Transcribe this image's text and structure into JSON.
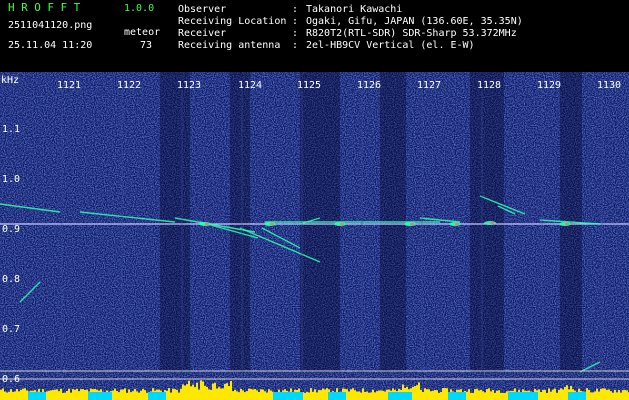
{
  "header": {
    "app_title": "HROFFT",
    "app_version": "1.0.0",
    "file_name": "2511041120.png",
    "timestamp": "25.11.04 11:20",
    "mode_label": "meteor",
    "mode_count": "73"
  },
  "info": [
    {
      "label": "Observer",
      "value": "Takanori Kawachi"
    },
    {
      "label": "Receiving Location",
      "value": "Ogaki, Gifu, JAPAN (136.60E, 35.35N)"
    },
    {
      "label": "Receiver",
      "value": "R820T2(RTL-SDR) SDR-Sharp 53.372MHz"
    },
    {
      "label": "Receiving antenna",
      "value": "2el-HB9CV Vertical (el. E-W)"
    }
  ],
  "axis": {
    "unit": "kHz",
    "time_labels": [
      "1121",
      "1122",
      "1123",
      "1124",
      "1125",
      "1126",
      "1127",
      "1128",
      "1129",
      "1130"
    ],
    "freq_labels": [
      "1.1",
      "1.0",
      "0.9",
      "0.8",
      "0.7",
      "0.6"
    ]
  },
  "colors": {
    "header_green": "#39ff3a",
    "background_blue": "#0a1a6a",
    "carrier_line": "#c8c8ff",
    "echo": "#2cffb0",
    "signal_bar_yellow": "#ffe800",
    "signal_bar_cyan": "#00d8ff"
  }
}
